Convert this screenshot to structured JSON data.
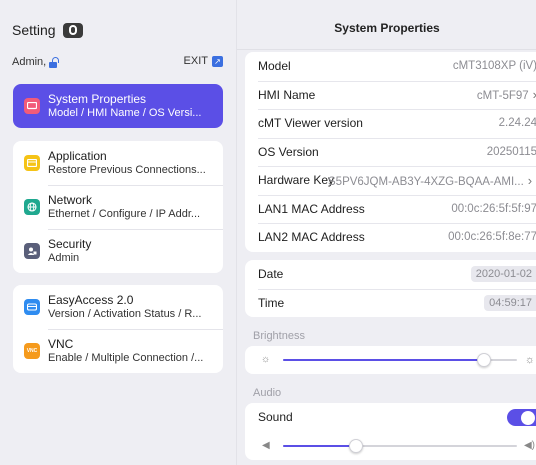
{
  "app": {
    "title": "Setting"
  },
  "user": {
    "name": "Admin,"
  },
  "exit": {
    "label": "EXIT"
  },
  "menu": {
    "groups": [
      [
        {
          "title": "System Properties",
          "subtitle": "Model / HMI Name / OS Versi...",
          "icon": "system-properties-icon",
          "color": "#f25b7a",
          "selected": true
        }
      ],
      [
        {
          "title": "Application",
          "subtitle": "Restore Previous Connections...",
          "icon": "application-icon",
          "color": "#f5c316"
        },
        {
          "title": "Network",
          "subtitle": "Ethernet / Configure / IP Addr...",
          "icon": "network-icon",
          "color": "#1fa88f"
        },
        {
          "title": "Security",
          "subtitle": "Admin",
          "icon": "security-icon",
          "color": "#5a5f7a"
        }
      ],
      [
        {
          "title": "EasyAccess 2.0",
          "subtitle": "Version / Activation Status / R...",
          "icon": "easyaccess-icon",
          "color": "#2f8cf0"
        },
        {
          "title": "VNC",
          "subtitle": "Enable / Multiple Connection /...",
          "icon": "vnc-icon",
          "color": "#f59a1c",
          "icon_text": "VNC"
        }
      ]
    ]
  },
  "detail": {
    "title": "System Properties",
    "properties": {
      "model": {
        "label": "Model",
        "value": "cMT3108XP (iV)"
      },
      "hmi_name": {
        "label": "HMI Name",
        "value": "cMT-5F97"
      },
      "viewer_version": {
        "label": "cMT Viewer version",
        "value": "2.24.24"
      },
      "os_version": {
        "label": "OS Version",
        "value": "20250115"
      },
      "hardware_key": {
        "label": "Hardware Key",
        "value": "S5PV6JQM-AB3Y-4XZG-BQAA-AMI..."
      },
      "lan1_mac": {
        "label": "LAN1 MAC Address",
        "value": "00:0c:26:5f:5f:97"
      },
      "lan2_mac": {
        "label": "LAN2 MAC Address",
        "value": "00:0c:26:5f:8e:77"
      }
    },
    "datetime": {
      "date": {
        "label": "Date",
        "value": "2020-01-02"
      },
      "time": {
        "label": "Time",
        "value": "04:59:17"
      }
    },
    "brightness": {
      "label": "Brightness",
      "level": 0.86
    },
    "audio": {
      "label": "Audio",
      "sound": {
        "label": "Sound",
        "on": true
      },
      "volume_level": 0.31
    }
  },
  "colors": {
    "accent": "#5b4fe6",
    "link": "#3b6fe0"
  }
}
